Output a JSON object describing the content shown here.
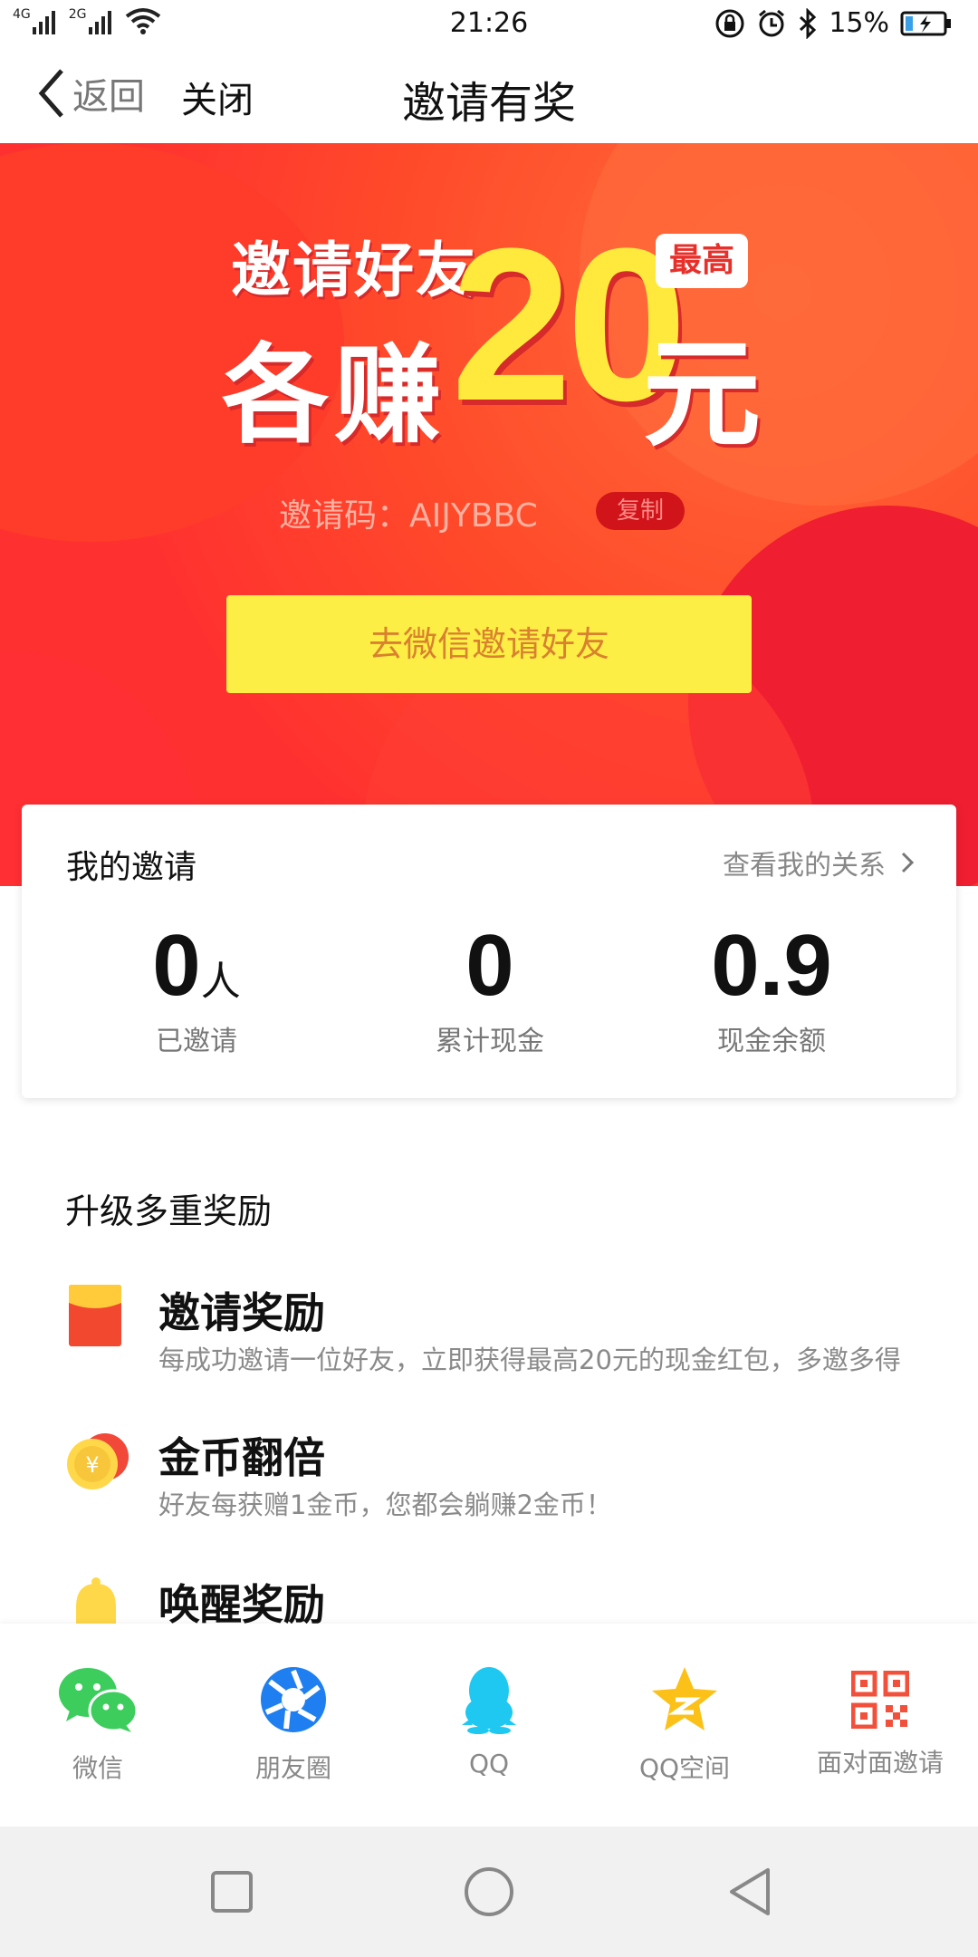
{
  "status_bar": {
    "network_1": "4G",
    "network_2": "2G",
    "time": "21:26",
    "battery": "15%",
    "icons": [
      "signal-icon",
      "wifi-icon",
      "lock-rotation-icon",
      "alarm-icon",
      "bluetooth-icon",
      "battery-icon"
    ]
  },
  "nav": {
    "back_label": "返回",
    "close_label": "关闭",
    "title": "邀请有奖"
  },
  "banner": {
    "line1": "邀请好友",
    "line2": "各赚",
    "amount": "20",
    "unit": "元",
    "badge": "最高",
    "invite_code_line": "邀请码：AIJYBBC",
    "copy_label": "复制",
    "invite_button": "去微信邀请好友"
  },
  "my_invite": {
    "title": "我的邀请",
    "link": "查看我的关系",
    "stats": [
      {
        "value": "0",
        "unit": "人",
        "label": "已邀请"
      },
      {
        "value": "0",
        "unit": "",
        "label": "累计现金"
      },
      {
        "value": "0.9",
        "unit": "",
        "label": "现金余额"
      }
    ]
  },
  "rewards": {
    "section_title": "升级多重奖励",
    "items": [
      {
        "title": "邀请奖励",
        "desc": "每成功邀请一位好友，立即获得最高20元的现金红包，多邀多得",
        "icon": "red-envelope-icon"
      },
      {
        "title": "金币翻倍",
        "desc": "好友每获赠1金币，您都会躺赚2金币！",
        "icon": "coin-icon"
      },
      {
        "title": "唤醒奖励",
        "desc": "",
        "icon": "bell-icon"
      }
    ]
  },
  "share": {
    "items": [
      {
        "label": "微信",
        "icon": "wechat-icon"
      },
      {
        "label": "朋友圈",
        "icon": "moments-icon"
      },
      {
        "label": "QQ",
        "icon": "qq-icon"
      },
      {
        "label": "QQ空间",
        "icon": "qzone-icon"
      },
      {
        "label": "面对面邀请",
        "icon": "qr-code-icon"
      }
    ]
  },
  "colors": {
    "banner_red": "#ff3a2e",
    "accent_yellow": "#fcee45",
    "copy_badge": "#d0141a"
  }
}
